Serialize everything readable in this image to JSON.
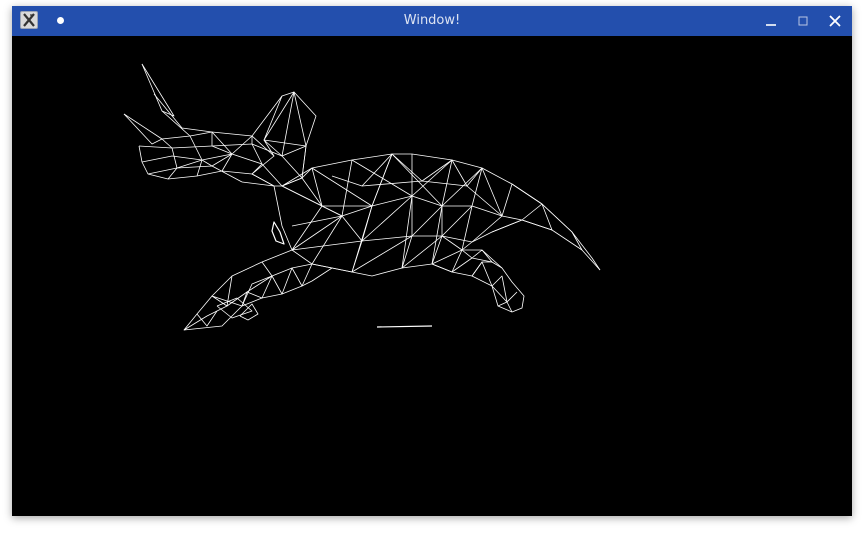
{
  "window": {
    "title": "Window!",
    "titlebar_color": "#234fad",
    "canvas_color": "#000000",
    "icons": {
      "app": "x-window-app-icon",
      "pin": "pin-dot-icon",
      "minimize": "minimize-icon",
      "maximize": "maximize-icon",
      "close": "close-icon"
    }
  },
  "scene": {
    "subject": "triceratops-wireframe",
    "line_color": "#ffffff"
  }
}
